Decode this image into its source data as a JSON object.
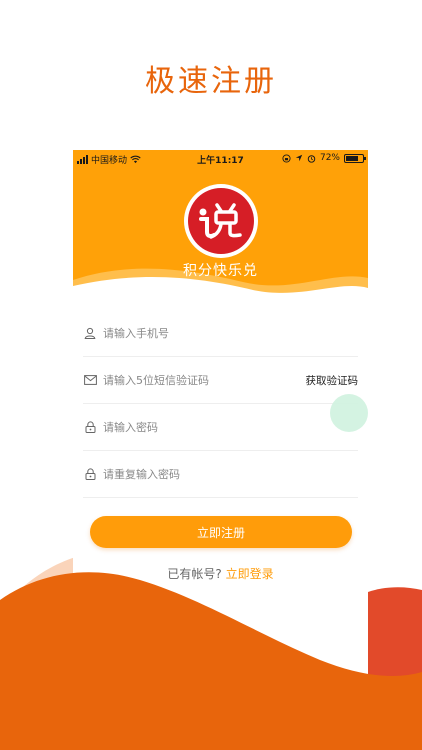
{
  "promo": {
    "title": "极速注册"
  },
  "status_bar": {
    "carrier": "中国移动",
    "time": "上午11:17",
    "battery": "72%",
    "battery_level": 0.72
  },
  "app": {
    "name": "积分快乐兑",
    "logo_text": "说兑"
  },
  "form": {
    "phone_placeholder": "请输入手机号",
    "code_placeholder": "请输入5位短信验证码",
    "get_code_label": "获取验证码",
    "password_placeholder": "请输入密码",
    "confirm_placeholder": "请重复输入密码",
    "submit_label": "立即注册"
  },
  "footer": {
    "have_account": "已有帐号?",
    "login_link": "立即登录"
  },
  "colors": {
    "brand_orange": "#FFA108",
    "title_orange": "#E8650C",
    "wave_dark": "#E8650C",
    "wave_red": "#E24A2A",
    "logo_red": "#D61E26"
  },
  "icons": [
    "signal-icon",
    "wifi-icon",
    "lock-rotation-icon",
    "location-icon",
    "alarm-icon",
    "battery-icon",
    "user-icon",
    "mail-icon",
    "lock-icon"
  ]
}
